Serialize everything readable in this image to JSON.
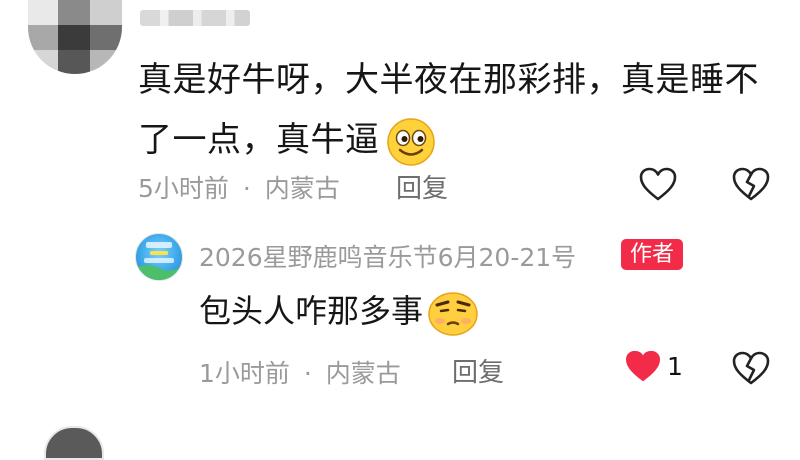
{
  "comment": {
    "text_line1": "真是好牛呀，大半夜在那彩排，真是睡不",
    "text_line2": "了一点，真牛逼",
    "time": "5小时前",
    "separator": "·",
    "location": "内蒙古",
    "reply_label": "回复"
  },
  "reply": {
    "author": "2026星野鹿鸣音乐节6月20-21号",
    "badge": "作者",
    "text": "包头人咋那多事",
    "time": "1小时前",
    "separator": "·",
    "location": "内蒙古",
    "reply_label": "回复",
    "like_count": "1"
  },
  "colors": {
    "like_active": "#f22b49",
    "meta_text": "#9a9a9a",
    "badge": "#f22b49"
  },
  "icons": {
    "comment_like": "heart-outline-icon",
    "comment_dislike": "broken-heart-outline-icon",
    "reply_like": "heart-filled-icon",
    "reply_dislike": "broken-heart-outline-icon",
    "emoji_1": "smiling-emoji-icon",
    "emoji_2": "annoyed-emoji-icon"
  }
}
